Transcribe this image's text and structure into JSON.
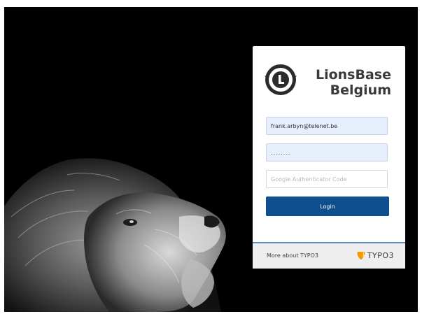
{
  "brand": {
    "line1": "LionsBase",
    "line2": "Belgium",
    "logo_icon": "lions-club-emblem-icon"
  },
  "form": {
    "username_value": "frank.arbyn@telenet.be",
    "password_value": "........",
    "mfa_placeholder": "Google Authenticator Code",
    "login_label": "Login"
  },
  "footer": {
    "more_link": "More about TYPO3",
    "typo3_wordmark": "TYPO3",
    "typo3_icon": "typo3-logo-icon"
  },
  "colors": {
    "background": "#000000",
    "button": "#0d4f8f",
    "autofill": "#e8effc",
    "footer_accent": "#5c8fbf",
    "typo3_orange": "#f49700"
  }
}
